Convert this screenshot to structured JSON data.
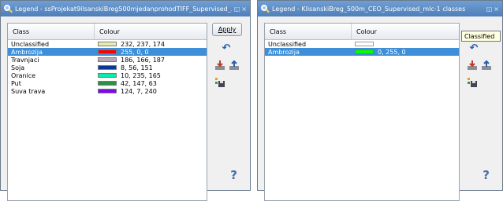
{
  "window1": {
    "title": "Legend - ssProjekat9ilsanskiBreg500mjedanprohodTIFF_Supervised_...",
    "title_buttons": [
      "◱",
      "×"
    ],
    "headers": {
      "class": "Class",
      "colour": "Colour"
    },
    "apply_label": "Apply",
    "help_label": "?",
    "rows": [
      {
        "cls": "Unclassified",
        "rgb": "232, 237, 174",
        "color": "#e8edae",
        "selected": false
      },
      {
        "cls": "Ambrozija",
        "rgb": "255, 0, 0",
        "color": "#ff0000",
        "selected": true
      },
      {
        "cls": "Travnjaci",
        "rgb": "186, 166, 187",
        "color": "#baa6bb",
        "selected": false
      },
      {
        "cls": "Soja",
        "rgb": "8, 56, 151",
        "color": "#083897",
        "selected": false
      },
      {
        "cls": "Oranice",
        "rgb": "10, 235, 165",
        "color": "#0aeba5",
        "selected": false
      },
      {
        "cls": "Put",
        "rgb": "42, 147, 63",
        "color": "#2a933f",
        "selected": false
      },
      {
        "cls": "Suva trava",
        "rgb": "124, 7, 240",
        "color": "#7c07f0",
        "selected": false
      }
    ]
  },
  "window2": {
    "title": "Legend - KlisanskiBreg_500m_CEO_Supervised_mlc-1 classes",
    "title_buttons": [
      "◱",
      "×"
    ],
    "headers": {
      "class": "Class",
      "colour": "Colour"
    },
    "tooltip": "Classified",
    "help_label": "?",
    "rows": [
      {
        "cls": "Unclassified",
        "rgb": "",
        "color": "",
        "selected": false
      },
      {
        "cls": "Ambrozija",
        "rgb": "0, 255, 0",
        "color": "#00ff00",
        "selected": true
      }
    ]
  },
  "colors": {
    "titlebar": "#5a8ac4",
    "selection": "#3c8fd8"
  }
}
